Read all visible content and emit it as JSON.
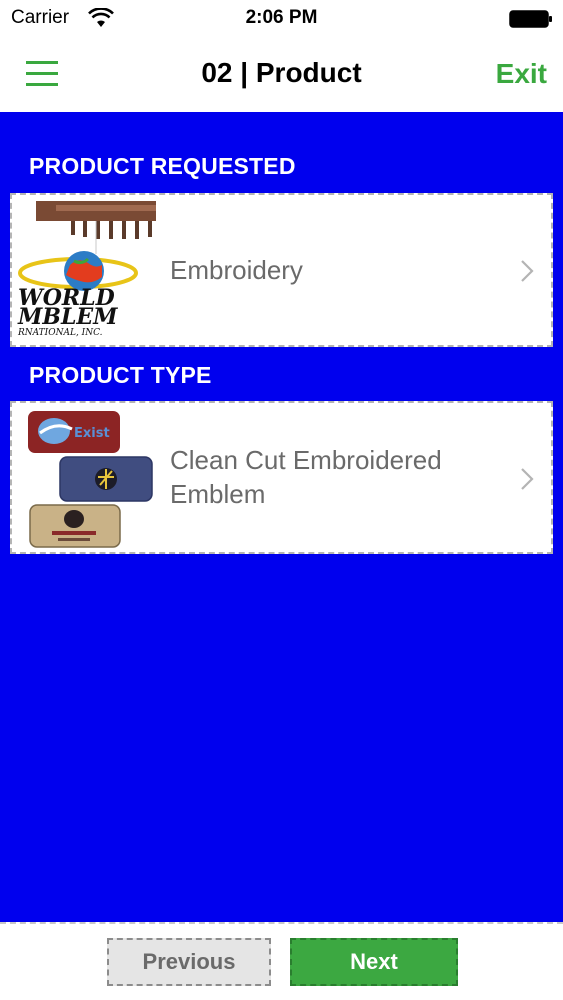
{
  "status_bar": {
    "carrier": "Carrier",
    "time": "2:06 PM"
  },
  "nav": {
    "title": "02 | Product",
    "exit_label": "Exit",
    "accent_color": "#3aa83f"
  },
  "main": {
    "background_color": "#0000ee",
    "product_requested": {
      "section_title": "PRODUCT REQUESTED",
      "item_label": "Embroidery",
      "logo_text": [
        "WORLD",
        "MBLEM",
        "RNATIONAL, INC."
      ]
    },
    "product_type": {
      "section_title": "PRODUCT TYPE",
      "item_label_line1": "Clean Cut Embroidered",
      "item_label_line2": "Emblem",
      "patch_text": "Exist"
    }
  },
  "footer": {
    "previous_label": "Previous",
    "next_label": "Next"
  },
  "icons": [
    "menu-icon",
    "wifi-icon",
    "battery-icon",
    "chevron-right-icon"
  ]
}
